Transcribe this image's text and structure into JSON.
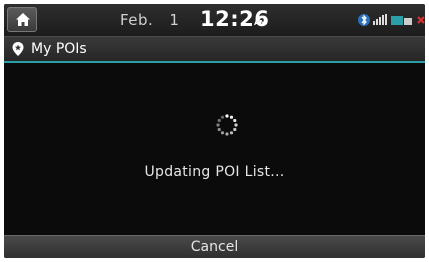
{
  "status_bar": {
    "date_month": "Feb.",
    "date_day": "1",
    "time": "12:26",
    "ampm": "AM",
    "icons": [
      "bluetooth-icon",
      "signal-strength-icon",
      "lte-icon",
      "mute-icon"
    ]
  },
  "header": {
    "title": "My POIs",
    "icon": "poi-pin-icon"
  },
  "main": {
    "spinner_icon": "loading-spinner-icon",
    "message": "Updating POI List..."
  },
  "footer": {
    "cancel_label": "Cancel"
  },
  "colors": {
    "background": "#0b0b0b",
    "accent": "#2a9fa8",
    "alert": "#e03030"
  }
}
